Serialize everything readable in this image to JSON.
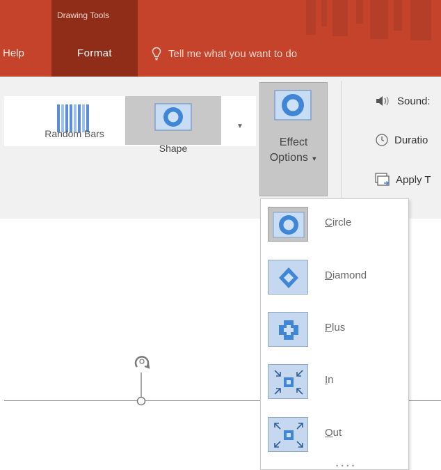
{
  "topbar": {
    "context_group": "Drawing Tools",
    "tab_help": "Help",
    "tab_format": "Format",
    "tell_me": "Tell me what you want to do"
  },
  "ribbon": {
    "random_bars_label": "Random Bars",
    "shape_label": "Shape",
    "effect_options_line1": "Effect",
    "effect_options_line2": "Options",
    "sound_label": "Sound:",
    "duration_label": "Duratio",
    "apply_label": "Apply T"
  },
  "menu": {
    "items": [
      {
        "label": "Circle",
        "mnemonic": "C",
        "rest": "ircle"
      },
      {
        "label": "Diamond",
        "mnemonic": "D",
        "rest": "iamond"
      },
      {
        "label": "Plus",
        "mnemonic": "P",
        "rest": "lus"
      },
      {
        "label": "In",
        "mnemonic": "I",
        "rest": "n"
      },
      {
        "label": "Out",
        "mnemonic": "O",
        "rest": "ut"
      }
    ],
    "selected": "Circle"
  },
  "colors": {
    "title_bar": "#c4432a",
    "context_group": "#8f2d19",
    "ribbon_bg": "#f1f1f1",
    "icon_blue": "#3f86d6",
    "tile_blue": "#c6d8ef"
  }
}
